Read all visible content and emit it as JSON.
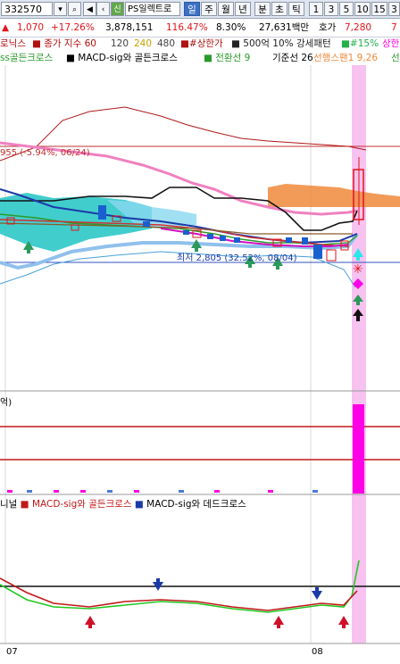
{
  "toolbar": {
    "stock_code": "332570",
    "badge_new": "신",
    "stock_name": "PS일렉트로",
    "periods": [
      "일",
      "주",
      "월",
      "년",
      "분",
      "초",
      "틱"
    ],
    "numbers": [
      "1",
      "3",
      "5",
      "10",
      "15",
      "3"
    ]
  },
  "price_row": {
    "arrow": "▲",
    "change": "1,070",
    "rate": "+17.26%",
    "volume": "3,878,151",
    "vol_ratio": "116.47%",
    "turnover": "8.30%",
    "amount": "27,631백만",
    "hoga_label": "호가",
    "hoga_value": "7,280",
    "hoga_tail": "7"
  },
  "legend1": {
    "item1": "로닉스",
    "item2": "종가 지수 60",
    "item3": "120",
    "item4": "240",
    "item5": "480",
    "item6": "#상한가",
    "item7": "500억 10% 강세패턴",
    "item8": "#15%",
    "item9": "상한"
  },
  "legend2": {
    "item1": "ss골든크로스",
    "item2": "MACD-sig와 골든크로스",
    "item3": "전환선 9",
    "item4": "기준선 26",
    "item5": "선행스팬1 9,26",
    "item6": "선"
  },
  "chart": {
    "high_label": "955 (-5.94%, 06/24)",
    "low_label": "최저 2,805 (32.52%, 08/04)",
    "volume_label": "억)",
    "macd_legend_1": "니널",
    "macd_legend_2": "MACD-sig와 골든크로스",
    "macd_legend_3": "MACD-sig와 데드크로스",
    "x_labels": [
      "07",
      "08"
    ]
  },
  "colors": {
    "up": "#e0161c",
    "down": "#1a5fd0",
    "highlight": "#f7c2f0",
    "magenta": "#ff00e6",
    "cloud_cyan": "#2ec8c8",
    "cloud_orange": "#f08a3c"
  }
}
